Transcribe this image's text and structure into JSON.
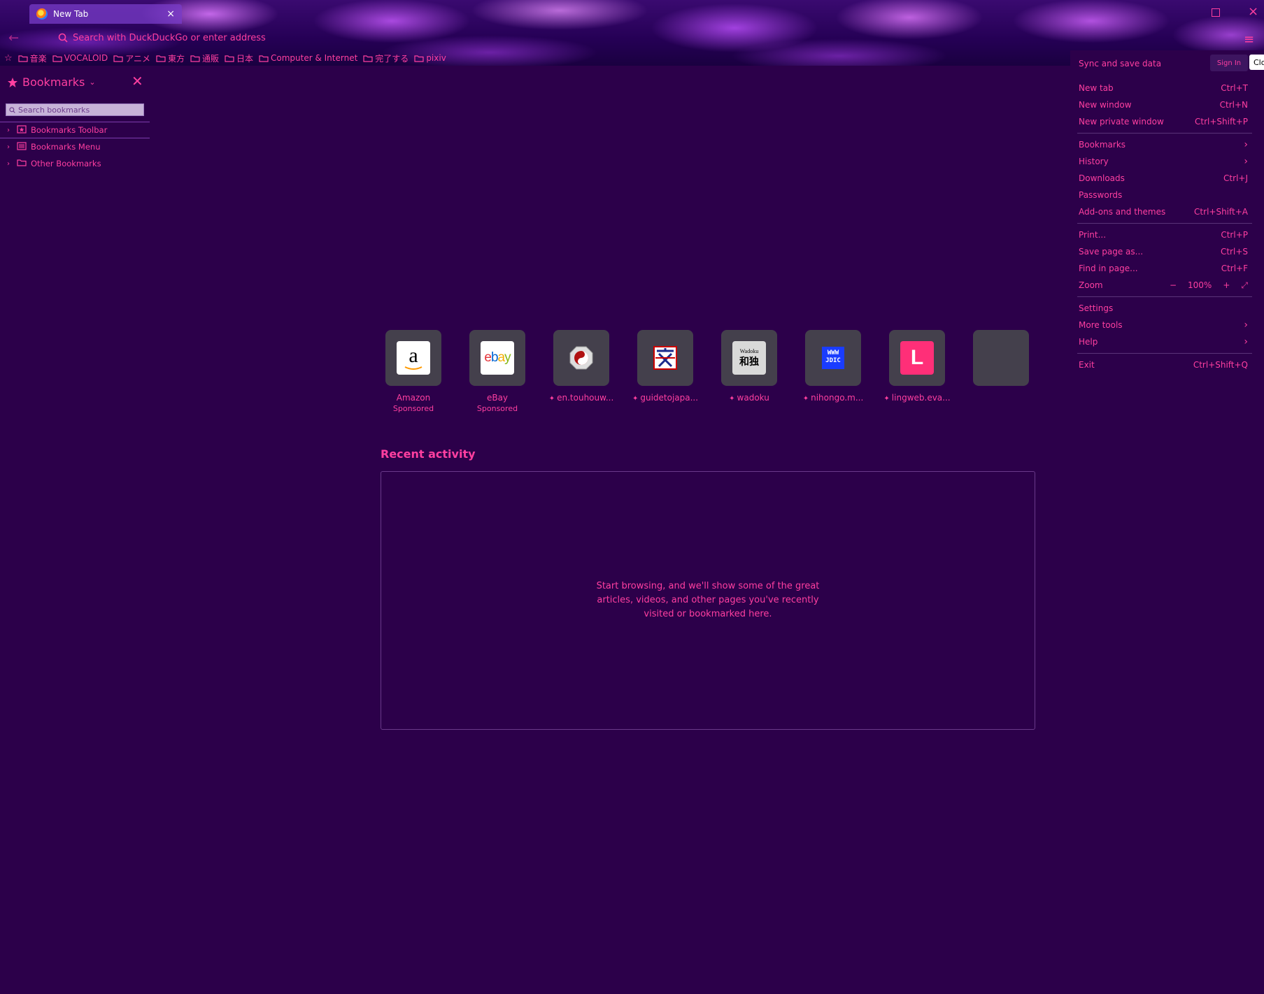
{
  "tab": {
    "title": "New Tab",
    "close": "×"
  },
  "window": {
    "close": "×"
  },
  "nav": {
    "back": "←",
    "url_placeholder": "Search with DuckDuckGo or enter address",
    "menu": "≡"
  },
  "bookmarks_toolbar": {
    "star": "☆",
    "folders": [
      "音楽",
      "VOCALOID",
      "アニメ",
      "東方",
      "通販",
      "日本",
      "Computer & Internet",
      "完了する",
      "pixiv"
    ]
  },
  "sidebar": {
    "title": "Bookmarks",
    "chevron": "⌄",
    "close": "✕",
    "search_placeholder": "Search bookmarks",
    "items": [
      {
        "label": "Bookmarks Toolbar"
      },
      {
        "label": "Bookmarks Menu"
      },
      {
        "label": "Other Bookmarks"
      }
    ]
  },
  "topsites": [
    {
      "label": "Amazon",
      "sub": "Sponsored",
      "pinned": false
    },
    {
      "label": "eBay",
      "sub": "Sponsored",
      "pinned": false
    },
    {
      "label": "en.touhouw...",
      "sub": "",
      "pinned": true
    },
    {
      "label": "guidetojapa...",
      "sub": "",
      "pinned": true
    },
    {
      "label": "wadoku",
      "sub": "",
      "pinned": true
    },
    {
      "label": "nihongo.m...",
      "sub": "",
      "pinned": true
    },
    {
      "label": "lingweb.eva...",
      "sub": "",
      "pinned": true
    },
    {
      "label": "",
      "sub": "",
      "pinned": false
    }
  ],
  "recent": {
    "title": "Recent activity",
    "message": "Start browsing, and we'll show some of the great articles, videos, and other pages you've recently visited or bookmarked here."
  },
  "app_menu": {
    "sync": "Sync and save data",
    "signin": "Sign In",
    "cl": "Clo",
    "groups": [
      [
        {
          "label": "New tab",
          "shortcut": "Ctrl+T"
        },
        {
          "label": "New window",
          "shortcut": "Ctrl+N"
        },
        {
          "label": "New private window",
          "shortcut": "Ctrl+Shift+P"
        }
      ],
      [
        {
          "label": "Bookmarks",
          "shortcut": "",
          "arrow": "›"
        },
        {
          "label": "History",
          "shortcut": "",
          "arrow": "›"
        },
        {
          "label": "Downloads",
          "shortcut": "Ctrl+J"
        },
        {
          "label": "Passwords",
          "shortcut": ""
        },
        {
          "label": "Add-ons and themes",
          "shortcut": "Ctrl+Shift+A"
        }
      ],
      [
        {
          "label": "Print...",
          "shortcut": "Ctrl+P"
        },
        {
          "label": "Save page as...",
          "shortcut": "Ctrl+S"
        },
        {
          "label": "Find in page...",
          "shortcut": "Ctrl+F"
        },
        {
          "label": "Zoom",
          "zoom": {
            "minus": "−",
            "level": "100%",
            "plus": "+",
            "full": "⤢"
          }
        }
      ],
      [
        {
          "label": "Settings",
          "shortcut": ""
        },
        {
          "label": "More tools",
          "shortcut": "",
          "arrow": "›"
        },
        {
          "label": "Help",
          "shortcut": "",
          "arrow": "›"
        }
      ],
      [
        {
          "label": "Exit",
          "shortcut": "Ctrl+Shift+Q"
        }
      ]
    ]
  },
  "colors": {
    "accent": "#ff3fa0",
    "background": "#2c004a",
    "tile": "#44404c"
  }
}
